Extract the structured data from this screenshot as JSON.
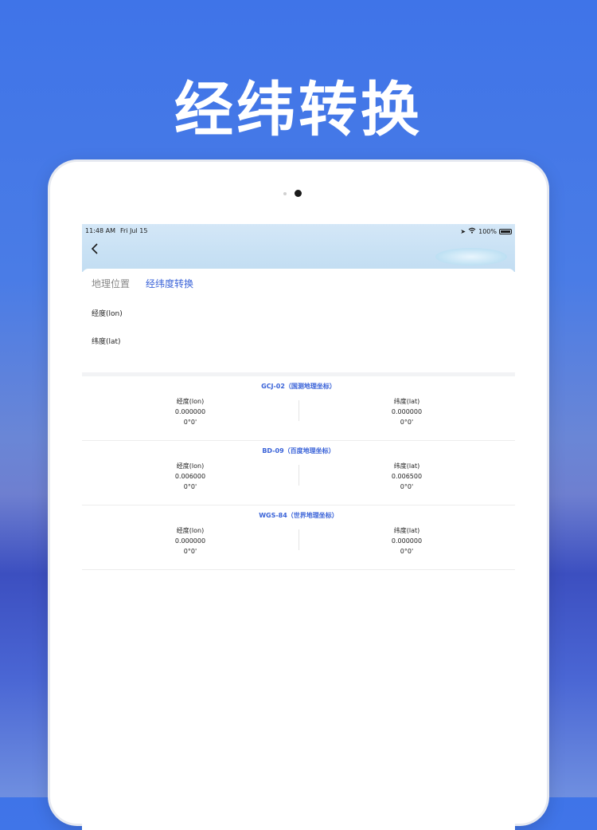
{
  "hero": {
    "title": "经纬转换"
  },
  "status_bar": {
    "time": "11:48 AM",
    "date": "Fri Jul 15",
    "battery": "100%"
  },
  "tabs": [
    {
      "label": "地理位置",
      "active": false
    },
    {
      "label": "经纬度转换",
      "active": true
    }
  ],
  "inputs": {
    "lon_label": "经度(lon)",
    "lat_label": "纬度(lat)",
    "lon_value": "",
    "lat_value": ""
  },
  "results": [
    {
      "title": "GCJ-02（国测地理坐标）",
      "lon_label": "经度(lon)",
      "lon_decimal": "0.000000",
      "lon_dms": "0°0'",
      "lat_label": "纬度(lat)",
      "lat_decimal": "0.000000",
      "lat_dms": "0°0'"
    },
    {
      "title": "BD-09（百度地理坐标）",
      "lon_label": "经度(lon)",
      "lon_decimal": "0.006000",
      "lon_dms": "0°0'",
      "lat_label": "纬度(lat)",
      "lat_decimal": "0.006500",
      "lat_dms": "0°0'"
    },
    {
      "title": "WGS-84（世界地理坐标）",
      "lon_label": "经度(lon)",
      "lon_decimal": "0.000000",
      "lon_dms": "0°0'",
      "lat_label": "纬度(lat)",
      "lat_decimal": "0.000000",
      "lat_dms": "0°0'"
    }
  ],
  "colors": {
    "accent": "#3a63d8",
    "background_top": "#3f74e8"
  },
  "icons": [
    "back-chevron-icon",
    "location-arrow-icon",
    "wifi-icon",
    "battery-icon"
  ]
}
